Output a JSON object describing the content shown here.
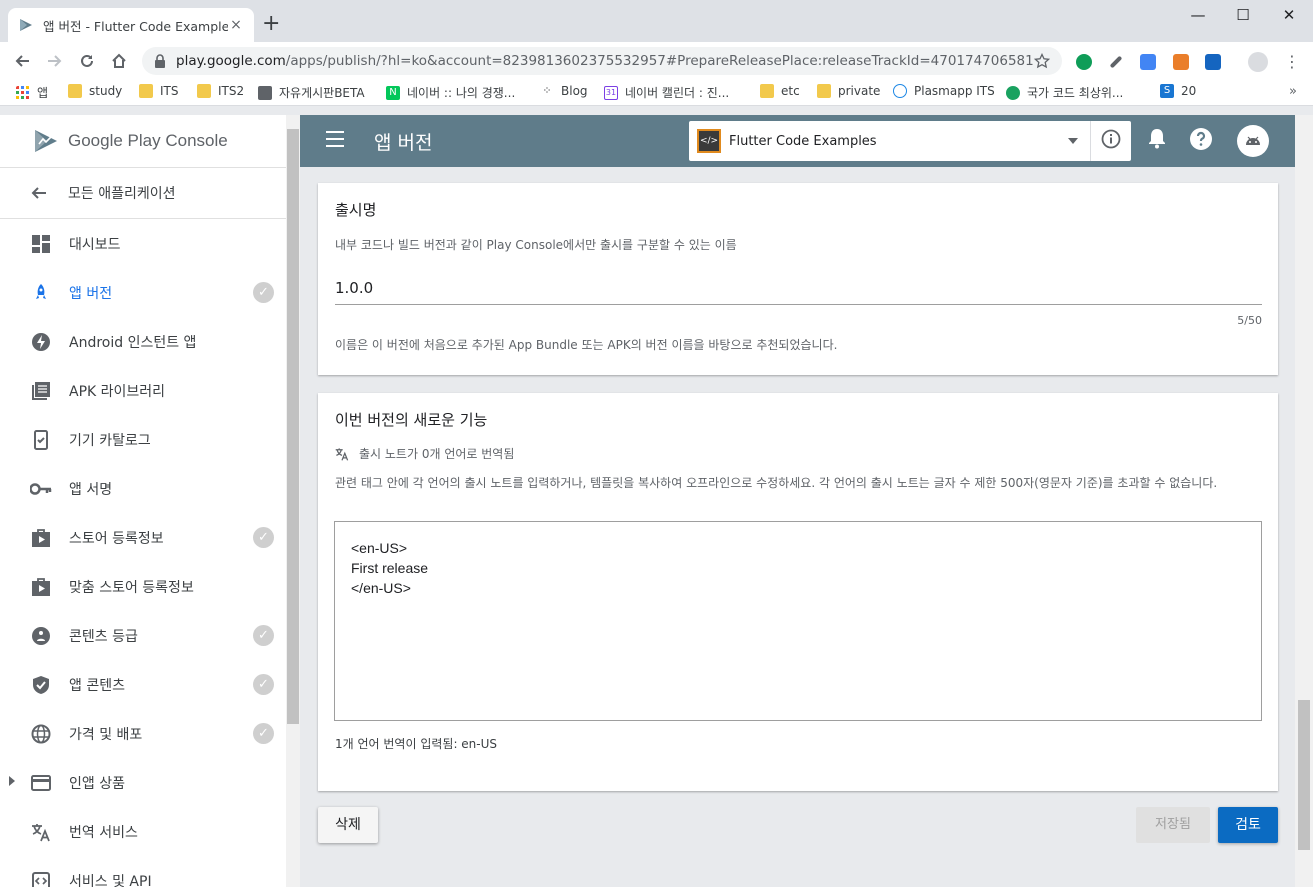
{
  "browser": {
    "tab_title": "앱 버전 - Flutter Code Examples",
    "tab_close": "×",
    "new_tab": "+",
    "url_host": "play.google.com",
    "url_path": "/apps/publish/?hl=ko&account=8239813602375532957#PrepareReleasePlace:releaseTrackId=470174706581256131...",
    "bookmarks": [
      "앱",
      "study",
      "ITS",
      "ITS2",
      "자유게시판BETA",
      "네이버 :: 나의 경쟁...",
      "Blog",
      "네이버 캘린더 : 진...",
      "etc",
      "private",
      "Plasmapp ITS",
      "국가 코드 최상위...",
      "20"
    ],
    "bookmarks_more": "»",
    "minimize": "—",
    "maximize": "☐",
    "close": "✕"
  },
  "sidebar": {
    "brand": "Google Play Console",
    "back_label": "모든 애플리케이션",
    "items": [
      {
        "label": "대시보드"
      },
      {
        "label": "앱 버전"
      },
      {
        "label": "Android 인스턴트 앱"
      },
      {
        "label": "APK 라이브러리"
      },
      {
        "label": "기기 카탈로그"
      },
      {
        "label": "앱 서명"
      },
      {
        "label": "스토어 등록정보"
      },
      {
        "label": "맞춤 스토어 등록정보"
      },
      {
        "label": "콘텐츠 등급"
      },
      {
        "label": "앱 콘텐츠"
      },
      {
        "label": "가격 및 배포"
      },
      {
        "label": "인앱 상품"
      },
      {
        "label": "번역 서비스"
      },
      {
        "label": "서비스 및 API"
      }
    ],
    "check_glyph": "✓"
  },
  "header": {
    "title": "앱 버전",
    "app_name": "Flutter Code Examples"
  },
  "release_name": {
    "title": "출시명",
    "hint": "내부 코드나 빌드 버전과 같이 Play Console에서만 출시를 구분할 수 있는 이름",
    "value": "1.0.0",
    "counter": "5/50",
    "suggestion": "이름은 이 버전에 처음으로 추가된 App Bundle 또는 APK의 버전 이름을 바탕으로 추천되었습니다."
  },
  "release_notes": {
    "title": "이번 버전의 새로운 기능",
    "translation_status": "출시 노트가 0개 언어로 번역됨",
    "hint": "관련 태그 안에 각 언어의 출시 노트를 입력하거나, 템플릿을 복사하여 오프라인으로 수정하세요. 각 언어의 출시 노트는 글자 수 제한 500자(영문자 기준)를 초과할 수 없습니다.",
    "lines": [
      "<en-US>",
      "First release",
      "</en-US>"
    ],
    "languages_entered": "1개 언어 번역이 입력됨: en-US"
  },
  "actions": {
    "delete": "삭제",
    "saved": "저장됨",
    "review": "검토"
  }
}
